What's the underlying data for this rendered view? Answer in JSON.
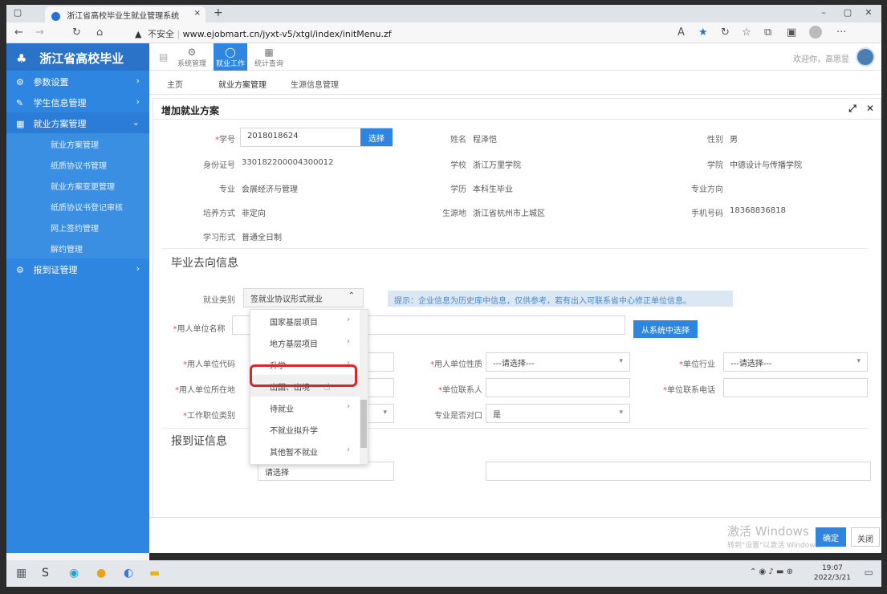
{
  "browser": {
    "tab_title": "浙江省高校毕业生就业管理系统",
    "tab_close": "×",
    "new_tab": "+",
    "security": "不安全",
    "url": "www.ejobmart.cn/jyxt-v5/xtgl/index/initMenu.zf"
  },
  "app": {
    "logo": "浙江省高校毕业",
    "welcome": "欢迎你，高思昱",
    "topnav": [
      {
        "label": "系统管理",
        "icon": "⚙"
      },
      {
        "label": "就业工作",
        "icon": "◯"
      },
      {
        "label": "统计查询",
        "icon": "▦"
      }
    ],
    "breadcrumbs": [
      "主页",
      "就业方案管理",
      "生源信息管理"
    ]
  },
  "sidebar": {
    "items": [
      {
        "label": "参数设置",
        "icon": "gear-icon"
      },
      {
        "label": "学生信息管理",
        "icon": "edit-icon"
      },
      {
        "label": "就业方案管理",
        "icon": "grid-icon"
      },
      {
        "label": "报到证管理",
        "icon": "gear-icon"
      }
    ],
    "subitems": [
      "就业方案管理",
      "纸质协议书管理",
      "就业方案变更管理",
      "纸质协议书登记审核",
      "网上签约管理",
      "解约管理"
    ]
  },
  "form": {
    "title": "增加就业方案",
    "student_id_label": "学号",
    "student_id": "2018018624",
    "select_btn": "选择",
    "name_label": "姓名",
    "name": "程泽恺",
    "gender_label": "性别",
    "gender": "男",
    "idcard_label": "身份证号",
    "idcard": "330182200004300012",
    "school_label": "学校",
    "school": "浙江万里学院",
    "college_label": "学院",
    "college": "中德设计与传播学院",
    "major_label": "专业",
    "major": "会展经济与管理",
    "degree_label": "学历",
    "degree": "本科生毕业",
    "direction_label": "专业方向",
    "training_label": "培养方式",
    "training": "非定向",
    "origin_label": "生源地",
    "origin": "浙江省杭州市上城区",
    "phone_label": "手机号码",
    "phone": "18368836818",
    "study_label": "学习形式",
    "study": "普通全日制",
    "section_grad": "毕业去向信息",
    "emp_type_label": "就业类别",
    "emp_type": "签就业协议形式就业",
    "tip": "提示：企业信息为历史库中信息，仅供参考，若有出入可联系省中心修正单位信息。",
    "employer_label": "用人单位名称",
    "from_system_btn": "从系统中选择",
    "employer_code_label": "用人单位代码",
    "employer_nature_label": "用人单位性质",
    "employer_nature": "---请选择---",
    "industry_label": "单位行业",
    "industry": "---请选择---",
    "employer_loc_label": "用人单位所在地",
    "contact_label": "单位联系人",
    "contact_phone_label": "单位联系电话",
    "job_type_label": "工作职位类别",
    "match_label": "专业是否对口",
    "match": "是",
    "section_report": "报到证信息",
    "bottom_select": "请选择"
  },
  "dropdown": {
    "options": [
      {
        "label": "国家基层项目",
        "sub": true
      },
      {
        "label": "地方基层项目",
        "sub": true
      },
      {
        "label": "升学",
        "sub": true
      },
      {
        "label": "出国、出境",
        "sub": false
      },
      {
        "label": "待就业",
        "sub": true
      },
      {
        "label": "不就业拟升学",
        "sub": false
      },
      {
        "label": "其他暂不就业",
        "sub": true
      }
    ]
  },
  "footer": {
    "watermark1": "激活 Windows",
    "watermark2": "转到\"设置\"以激活 Windows。",
    "ok": "确定",
    "close": "关闭"
  },
  "taskbar": {
    "time": "19:07",
    "date": "2022/3/21"
  },
  "colors": {
    "accent": "#2f86e0",
    "highlight": "#d9272c"
  }
}
